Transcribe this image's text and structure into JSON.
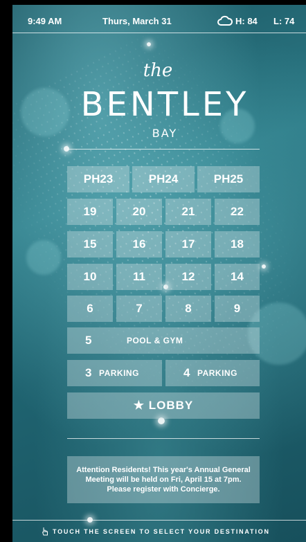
{
  "status_bar": {
    "time": "9:49 AM",
    "date": "Thurs, March 31",
    "weather_icon": "cloud-icon",
    "high": "H: 84",
    "low": "L: 74"
  },
  "logo": {
    "the": "the",
    "name": "BENTLEY",
    "sub": "BAY"
  },
  "floors": {
    "penthouse": [
      "PH23",
      "PH24",
      "PH25"
    ],
    "row1": [
      "19",
      "20",
      "21",
      "22"
    ],
    "row2": [
      "15",
      "16",
      "17",
      "18"
    ],
    "row3": [
      "10",
      "11",
      "12",
      "14"
    ],
    "row4": [
      "6",
      "7",
      "8",
      "9"
    ],
    "pool_num": "5",
    "pool_label": "POOL & GYM",
    "parking3_num": "3",
    "parking3_label": "PARKING",
    "parking4_num": "4",
    "parking4_label": "PARKING",
    "lobby": "★ LOBBY"
  },
  "notice": "Attention Residents! This year's Annual General Meeting will be held on Fri, April 15 at 7pm. Please register with Concierge.",
  "footer": {
    "icon": "hand-pointer-icon",
    "text": "TOUCH THE SCREEN TO SELECT YOUR DESTINATION"
  }
}
